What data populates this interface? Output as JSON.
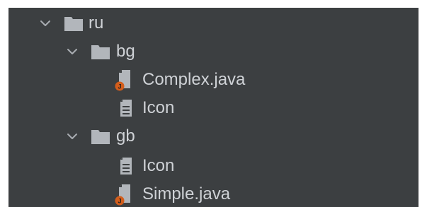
{
  "tree": {
    "ru": {
      "label": "ru",
      "icon": "folder-icon",
      "state": "expanded"
    },
    "bg": {
      "label": "bg",
      "icon": "folder-icon",
      "state": "expanded"
    },
    "complex_java": {
      "label": "Complex.java",
      "icon": "java-file-icon"
    },
    "bg_icon": {
      "label": "Icon",
      "icon": "text-file-icon"
    },
    "gb": {
      "label": "gb",
      "icon": "folder-icon",
      "state": "expanded"
    },
    "gb_icon": {
      "label": "Icon",
      "icon": "text-file-icon"
    },
    "simple_java": {
      "label": "Simple.java",
      "icon": "java-file-icon"
    }
  },
  "colors": {
    "background": "#3c3f41",
    "text": "#cfd2d6",
    "folder": "#b2b6bb",
    "chevron": "#a9adb2",
    "java_badge": "#d35d1b"
  }
}
